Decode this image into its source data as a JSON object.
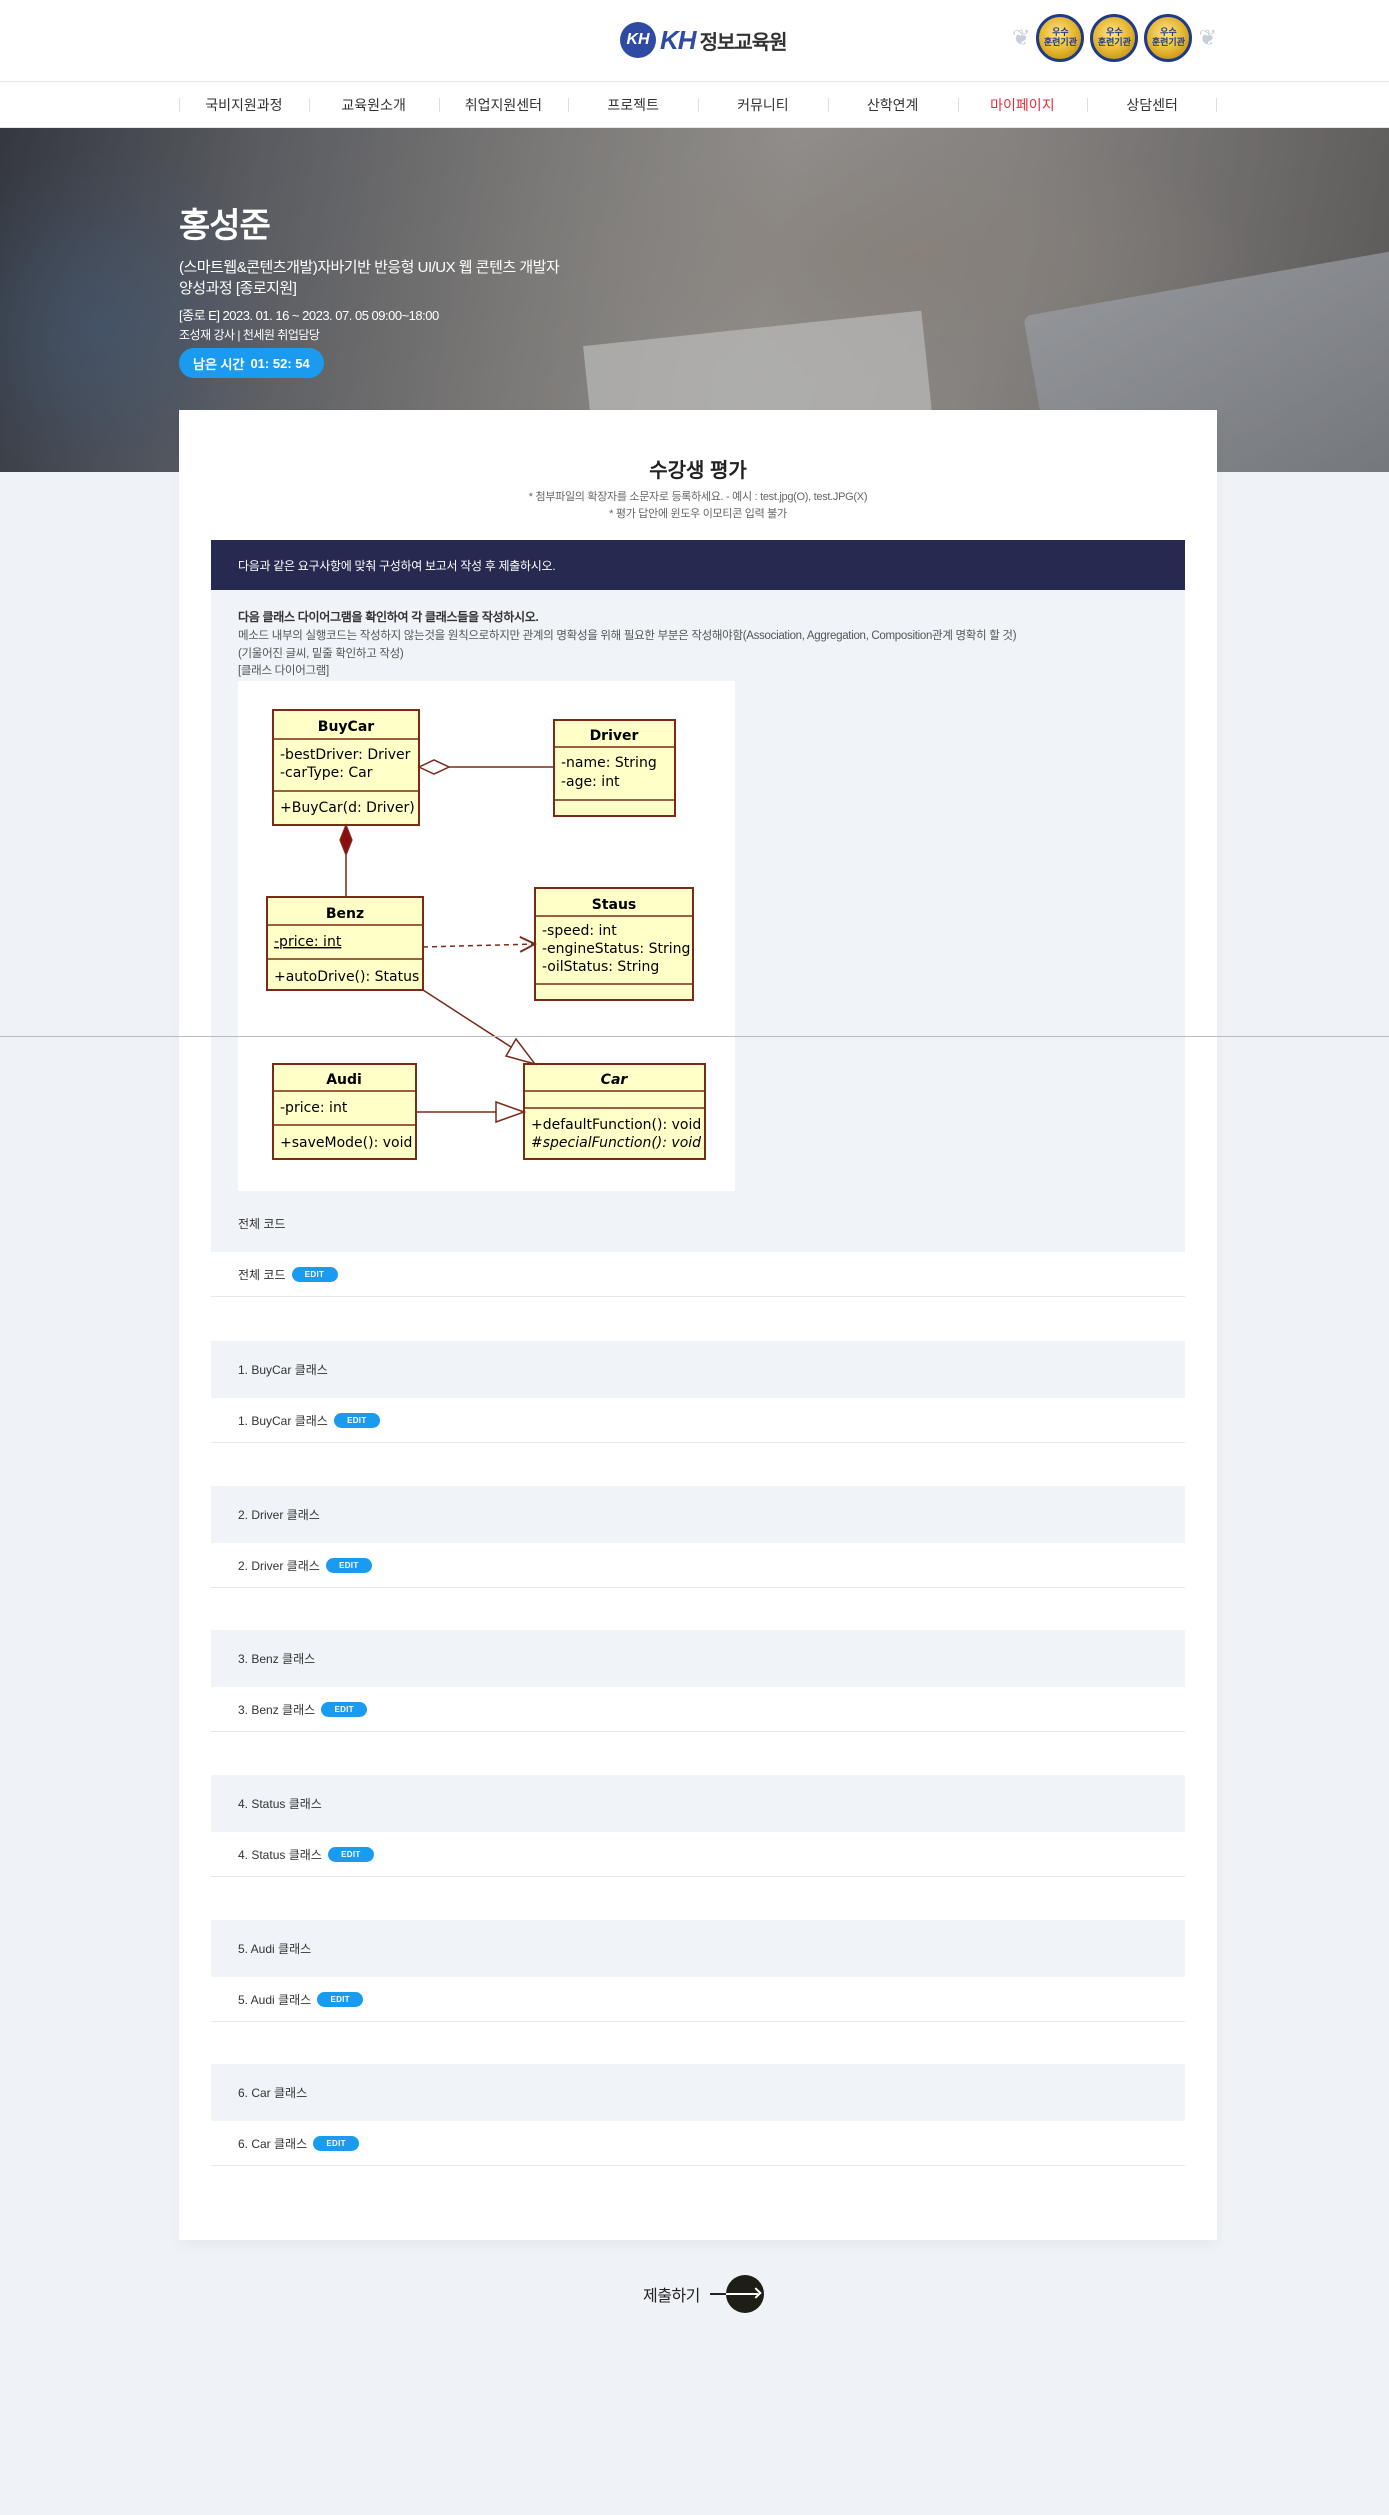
{
  "header": {
    "logo_mark": "KH",
    "logo_brand": "KH",
    "logo_text": "정보교육원",
    "badges": [
      "우수\n훈련기관",
      "우수\n훈련기관",
      "우수\n훈련기관"
    ]
  },
  "nav": {
    "items": [
      "국비지원과정",
      "교육원소개",
      "취업지원센터",
      "프로젝트",
      "커뮤니티",
      "산학연계",
      "마이페이지",
      "상담센터"
    ],
    "active_index": 6
  },
  "hero": {
    "name": "홍성준",
    "course_line1": "(스마트웹&콘텐츠개발)자바기반 반응형 UI/UX 웹 콘텐츠 개발자",
    "course_line2": "양성과정 [종로지원]",
    "date": "[종로 E] 2023. 01. 16 ~ 2023. 07. 05 09:00~18:00",
    "instructors": "조성재 강사 | 천세원 취업담당",
    "timer_label": "남은 시간",
    "timer_value": "01: 52: 54"
  },
  "card": {
    "title": "수강생 평가",
    "notice1": "* 첨부파일의 확장자를 소문자로 등록하세요. - 예시 : test.jpg(O), test.JPG(X)",
    "notice2": "* 평가 답안에 윈도우 이모티콘 입력 불가",
    "banner": "다음과 같은 요구사항에 맞춰 구성하여 보고서 작성 후 제출하시오.",
    "question": {
      "heading": "다음 클래스 다이어그램을 확인하여 각 클래스들을 작성하시오.",
      "line1": "메소드 내부의 실행코드는 작성하지 않는것을 원칙으로하지만 관계의 명확성을 위해 필요한 부분은 작성해야함(Association, Aggregation, Composition관계 명확히 할 것)",
      "line2": "(기울어진 글씨, 밑줄 확인하고 작성)",
      "line3": "[클래스 다이어그램]",
      "footer": "전체 코드"
    },
    "sections": [
      {
        "head": "",
        "label": "전체 코드"
      },
      {
        "head": "1. BuyCar 클래스",
        "label": "1. BuyCar 클래스"
      },
      {
        "head": "2. Driver 클래스",
        "label": "2. Driver 클래스"
      },
      {
        "head": "3. Benz 클래스",
        "label": "3. Benz 클래스"
      },
      {
        "head": "4. Status 클래스",
        "label": "4. Status 클래스"
      },
      {
        "head": "5. Audi 클래스",
        "label": "5. Audi 클래스"
      },
      {
        "head": "6. Car 클래스",
        "label": "6. Car 클래스"
      }
    ],
    "edit_label": "EDIT"
  },
  "diagram": {
    "classes": {
      "buycar": {
        "name": "BuyCar",
        "attrs": [
          "-bestDriver: Driver",
          "-carType: Car"
        ],
        "methods": [
          "+BuyCar(d: Driver)"
        ]
      },
      "driver": {
        "name": "Driver",
        "attrs": [
          "-name: String",
          "-age: int"
        ],
        "methods": []
      },
      "benz": {
        "name": "Benz",
        "attrs": [
          "-price: int"
        ],
        "methods": [
          "+autoDrive(): Status"
        ]
      },
      "staus": {
        "name": "Staus",
        "attrs": [
          "-speed: int",
          "-engineStatus: String",
          "-oilStatus: String"
        ],
        "methods": []
      },
      "audi": {
        "name": "Audi",
        "attrs": [
          "-price: int"
        ],
        "methods": [
          "+saveMode(): void"
        ]
      },
      "car": {
        "name": "Car",
        "attrs": [],
        "methods": [
          "+defaultFunction(): void",
          "#specialFunction(): void"
        ]
      }
    },
    "fill_color": "#ffffc8",
    "stroke_color": "#7a2b18"
  },
  "submit": {
    "label": "제출하기"
  },
  "colors": {
    "accent_blue": "#1b9bf0",
    "banner_navy": "#272a50",
    "nav_active": "#e52d3a"
  }
}
